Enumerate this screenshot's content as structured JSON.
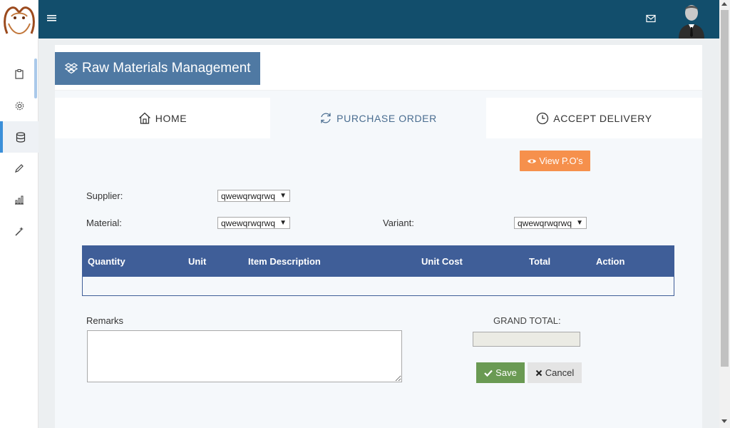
{
  "header": {
    "title": "Raw Materials Management"
  },
  "tabs": [
    {
      "label": "HOME",
      "icon": "home-icon"
    },
    {
      "label": "PURCHASE ORDER",
      "icon": "refresh-icon"
    },
    {
      "label": "ACCEPT DELIVERY",
      "icon": "clock-icon"
    }
  ],
  "sidebar": {
    "items": [
      {
        "icon": "clipboard-icon"
      },
      {
        "icon": "gear-icon"
      },
      {
        "icon": "database-icon",
        "active": true
      },
      {
        "icon": "pencil-icon"
      },
      {
        "icon": "bar-chart-icon"
      },
      {
        "icon": "magic-wand-icon"
      }
    ]
  },
  "actions": {
    "view_pos": "View P.O's",
    "save": "Save",
    "cancel": "Cancel"
  },
  "form": {
    "supplier_label": "Supplier:",
    "supplier_value": "qwewqrwqrwq",
    "material_label": "Material:",
    "material_value": "qwewqrwqrwq",
    "variant_label": "Variant:",
    "variant_value": "qwewqrwqrwq"
  },
  "table": {
    "columns": [
      "Quantity",
      "Unit",
      "Item Description",
      "Unit Cost",
      "Total",
      "Action"
    ],
    "rows": []
  },
  "remarks": {
    "label": "Remarks",
    "value": ""
  },
  "grand_total": {
    "label": "GRAND TOTAL:",
    "value": ""
  },
  "colors": {
    "topbar": "#124e6c",
    "title_badge": "#4f79a3",
    "table_header": "#3f5e98",
    "view_button": "#f6904c",
    "save_button": "#6a9a53"
  }
}
